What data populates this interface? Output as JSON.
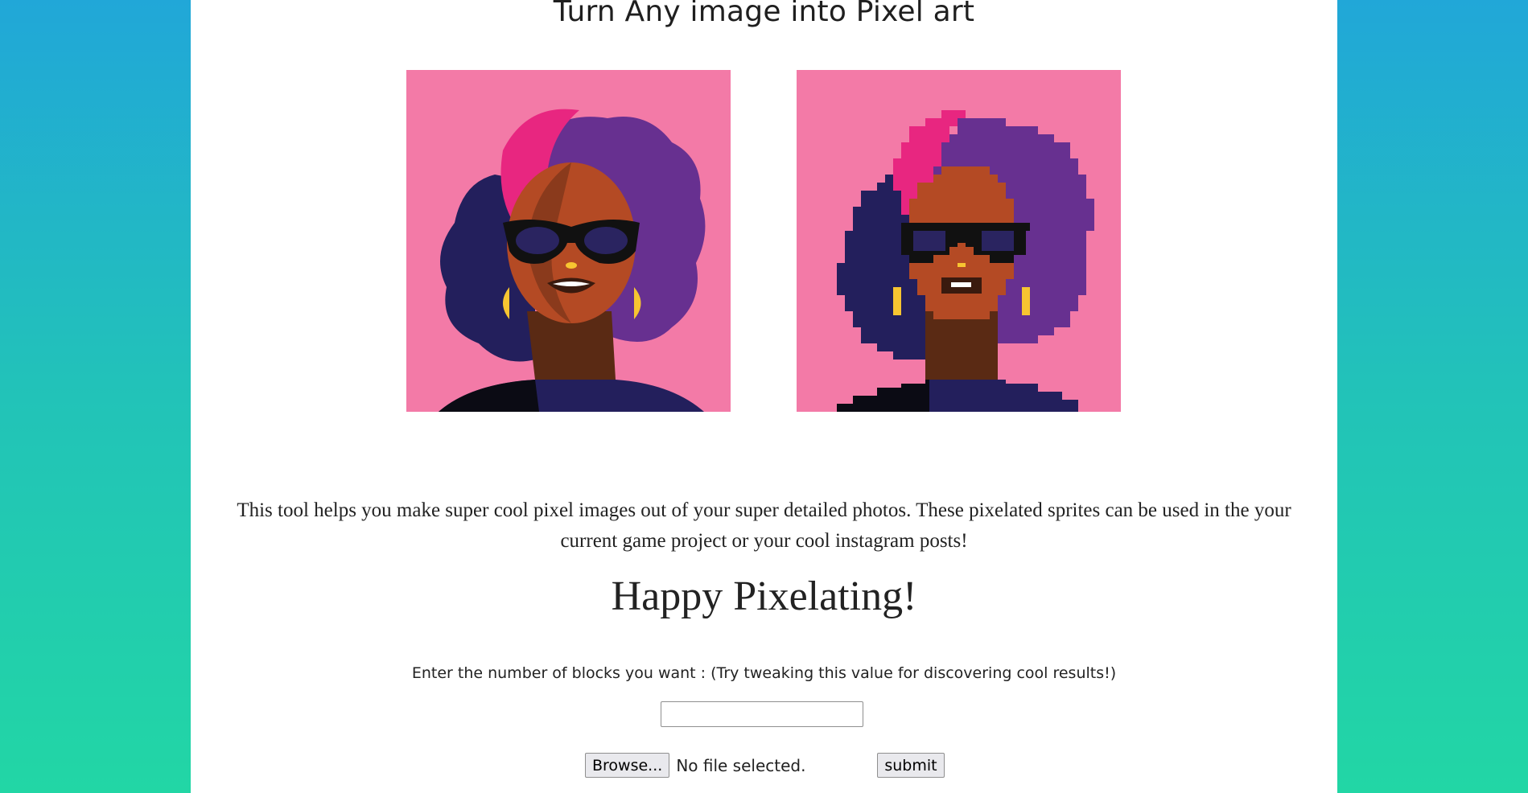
{
  "page": {
    "title": "Turn Any image into Pixel art",
    "description": "This tool helps you make super cool pixel images out of your super detailed photos. These pixelated sprites can be used in the your current game project or your cool instagram posts!",
    "tagline": "Happy Pixelating!"
  },
  "form": {
    "prompt": "Enter the number of blocks you want : (Try tweaking this value for discovering cool results!)",
    "blocks_value": "",
    "browse_label": "Browse...",
    "file_status": "No file selected.",
    "submit_label": "submit"
  },
  "colors": {
    "background_top": "#21a7d8",
    "background_bottom": "#22d6a5",
    "art_background": "#f37aa7",
    "hair_purple": "#673090",
    "hair_pink": "#e82680",
    "hair_navy": "#231f5c",
    "skin": "#b44a24",
    "earring": "#f7c531"
  },
  "icons": {
    "original_image": "afro-woman-illustration",
    "pixel_image": "afro-woman-pixel-illustration"
  }
}
